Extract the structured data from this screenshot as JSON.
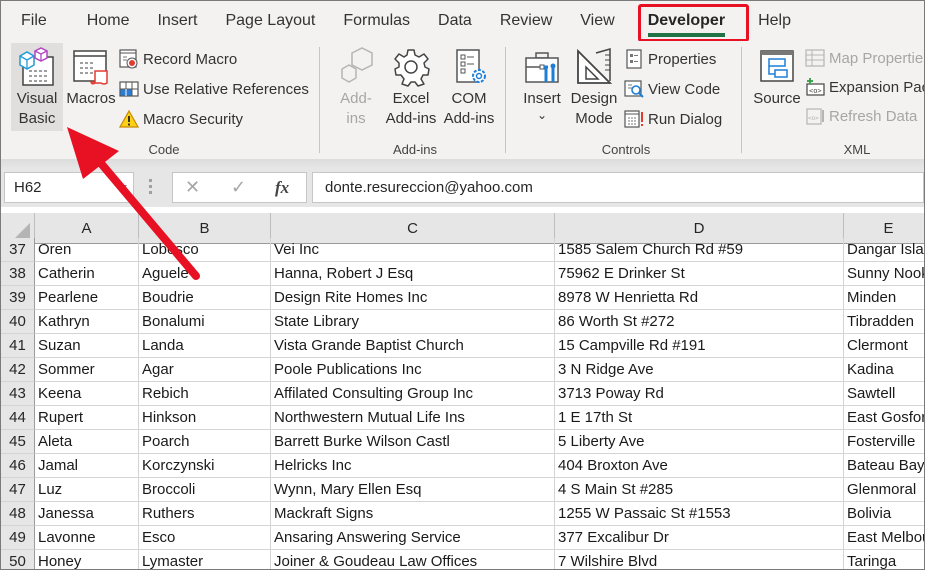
{
  "tabs": [
    {
      "label": "File",
      "active": false
    },
    {
      "label": "Home",
      "active": false
    },
    {
      "label": "Insert",
      "active": false
    },
    {
      "label": "Page Layout",
      "active": false
    },
    {
      "label": "Formulas",
      "active": false
    },
    {
      "label": "Data",
      "active": false
    },
    {
      "label": "Review",
      "active": false
    },
    {
      "label": "View",
      "active": false
    },
    {
      "label": "Developer",
      "active": true
    },
    {
      "label": "Help",
      "active": false
    }
  ],
  "ribbon": {
    "code": {
      "label": "Code",
      "visual_basic": "Visual Basic",
      "visual_basic_l1": "Visual",
      "visual_basic_l2": "Basic",
      "macros": "Macros",
      "record_macro": "Record Macro",
      "use_relative_references": "Use Relative References",
      "macro_security": "Macro Security"
    },
    "addins": {
      "label": "Add-ins",
      "addins_l1": "Add-",
      "addins_l2": "ins",
      "excel_addins_l1": "Excel",
      "excel_addins_l2": "Add-ins",
      "com_addins_l1": "COM",
      "com_addins_l2": "Add-ins"
    },
    "controls": {
      "label": "Controls",
      "insert": "Insert",
      "insert_caret": "⌄",
      "design_mode_l1": "Design",
      "design_mode_l2": "Mode",
      "properties": "Properties",
      "view_code": "View Code",
      "run_dialog": "Run Dialog"
    },
    "xml": {
      "label": "XML",
      "source": "Source",
      "map_properties": "Map Properties",
      "expansion_packs": "Expansion Packs",
      "refresh_data": "Refresh Data"
    }
  },
  "formula_bar": {
    "name_box": "H62",
    "cancel_icon": "✕",
    "enter_icon": "✓",
    "fx_label": "fx",
    "formula": "donte.resureccion@yahoo.com"
  },
  "columns": [
    "A",
    "B",
    "C",
    "D",
    "E"
  ],
  "rows": [
    {
      "n": "37",
      "cells": [
        "Oren",
        "Lobosco",
        "Vei Inc",
        "1585 Salem Church Rd #59",
        "Dangar Island"
      ]
    },
    {
      "n": "38",
      "cells": [
        "Catherin",
        "Aguele",
        "Hanna, Robert J Esq",
        "75962 E Drinker St",
        "Sunny Nook"
      ]
    },
    {
      "n": "39",
      "cells": [
        "Pearlene",
        "Boudrie",
        "Design Rite Homes Inc",
        "8978 W Henrietta Rd",
        "Minden"
      ]
    },
    {
      "n": "40",
      "cells": [
        "Kathryn",
        "Bonalumi",
        "State Library",
        "86 Worth St #272",
        "Tibradden"
      ]
    },
    {
      "n": "41",
      "cells": [
        "Suzan",
        "Landa",
        "Vista Grande Baptist Church",
        "15 Campville Rd #191",
        "Clermont"
      ]
    },
    {
      "n": "42",
      "cells": [
        "Sommer",
        "Agar",
        "Poole Publications Inc",
        "3 N Ridge Ave",
        "Kadina"
      ]
    },
    {
      "n": "43",
      "cells": [
        "Keena",
        "Rebich",
        "Affilated Consulting Group Inc",
        "3713 Poway Rd",
        "Sawtell"
      ]
    },
    {
      "n": "44",
      "cells": [
        "Rupert",
        "Hinkson",
        "Northwestern Mutual Life Ins",
        "1 E 17th St",
        "East Gosford"
      ]
    },
    {
      "n": "45",
      "cells": [
        "Aleta",
        "Poarch",
        "Barrett Burke Wilson Castl",
        "5 Liberty Ave",
        "Fosterville"
      ]
    },
    {
      "n": "46",
      "cells": [
        "Jamal",
        "Korczynski",
        "Helricks Inc",
        "404 Broxton Ave",
        "Bateau Bay"
      ]
    },
    {
      "n": "47",
      "cells": [
        "Luz",
        "Broccoli",
        "Wynn, Mary Ellen Esq",
        "4 S Main St #285",
        "Glenmoral"
      ]
    },
    {
      "n": "48",
      "cells": [
        "Janessa",
        "Ruthers",
        "Mackraft Signs",
        "1255 W Passaic St #1553",
        "Bolivia"
      ]
    },
    {
      "n": "49",
      "cells": [
        "Lavonne",
        "Esco",
        "Ansaring Answering Service",
        "377 Excalibur Dr",
        "East Melbourne"
      ]
    },
    {
      "n": "50",
      "cells": [
        "Honey",
        "Lymaster",
        "Joiner & Goudeau Law Offices",
        "7 Wilshire Blvd",
        "Taringa"
      ]
    }
  ],
  "annotation": {
    "highlight_color": "#e81123",
    "accent_color": "#217346"
  }
}
